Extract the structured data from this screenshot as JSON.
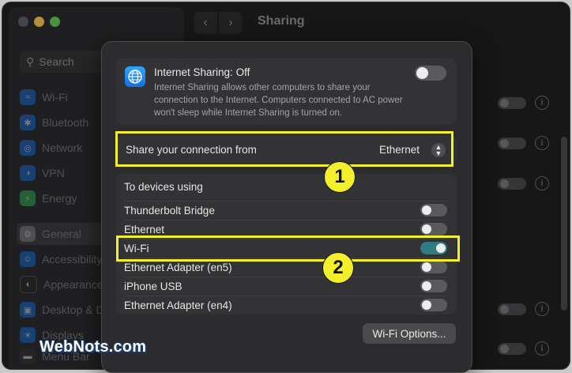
{
  "window": {
    "title": "Sharing"
  },
  "sidebar": {
    "search_placeholder": "Search",
    "items": [
      {
        "label": "Wi-Fi",
        "icon": "wifi-icon",
        "color": "#1a7cf5"
      },
      {
        "label": "Bluetooth",
        "icon": "bluetooth-icon",
        "color": "#1a7cf5"
      },
      {
        "label": "Network",
        "icon": "globe-icon",
        "color": "#1a7cf5"
      },
      {
        "label": "VPN",
        "icon": "vpn-icon",
        "color": "#1a7cf5"
      },
      {
        "label": "Energy",
        "icon": "bolt-icon",
        "color": "#34c759"
      },
      {
        "label": "General",
        "icon": "gear-icon",
        "color": "#8e8e93"
      },
      {
        "label": "Accessibility",
        "icon": "accessibility-icon",
        "color": "#1a7cf5"
      },
      {
        "label": "Appearance",
        "icon": "appearance-icon",
        "color": "#2c2c2e"
      },
      {
        "label": "Desktop & D",
        "icon": "desktop-icon",
        "color": "#1a7cf5"
      },
      {
        "label": "Displays",
        "icon": "display-icon",
        "color": "#1a7cf5"
      },
      {
        "label": "Menu Bar",
        "icon": "menubar-icon",
        "color": "#3a3a3c"
      }
    ]
  },
  "internet_sharing": {
    "title": "Internet Sharing: Off",
    "description": "Internet Sharing allows other computers to share your connection to the Internet. Computers connected to AC power won't sleep while Internet Sharing is turned on.",
    "enabled": false
  },
  "share_from": {
    "label": "Share your connection from",
    "value": "Ethernet"
  },
  "devices": {
    "header": "To devices using",
    "rows": [
      {
        "label": "Thunderbolt Bridge",
        "on": false
      },
      {
        "label": "Ethernet",
        "on": false
      },
      {
        "label": "Wi-Fi",
        "on": true
      },
      {
        "label": "Ethernet Adapter (en5)",
        "on": false
      },
      {
        "label": "iPhone USB",
        "on": false
      },
      {
        "label": "Ethernet Adapter (en4)",
        "on": false
      }
    ]
  },
  "wifi_options_button": "Wi-Fi Options...",
  "annotations": {
    "badge1": "1",
    "badge2": "2",
    "highlight_color": "#f3ef2a"
  },
  "watermark": "WebNots.com"
}
